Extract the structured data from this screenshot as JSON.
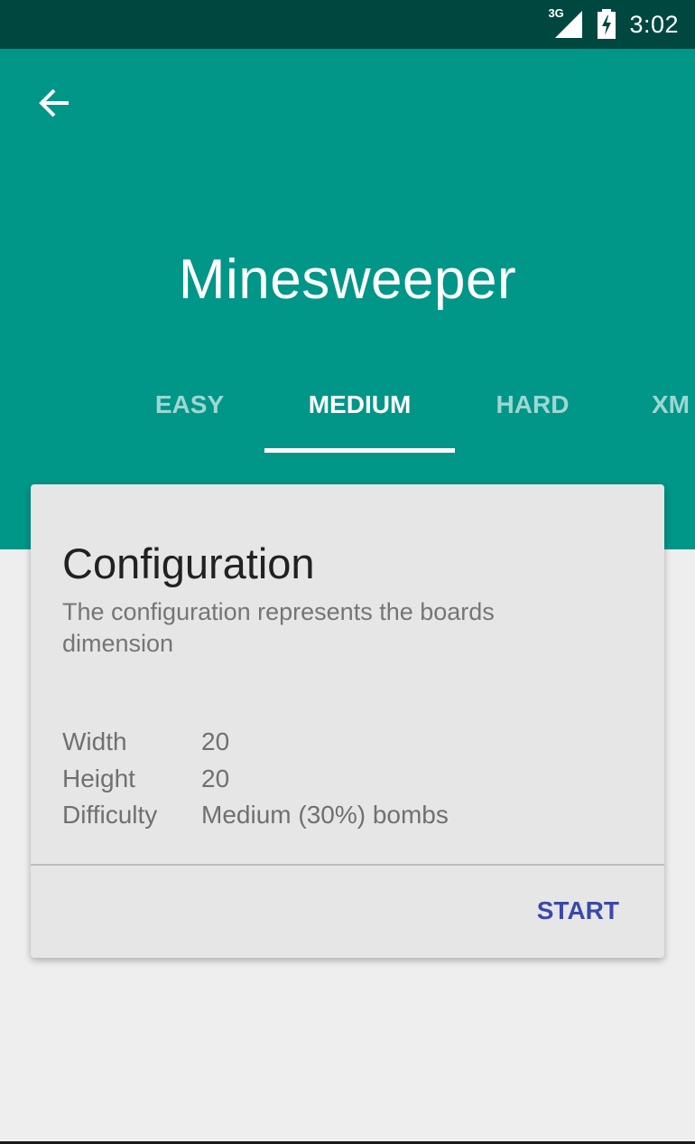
{
  "status_bar": {
    "network_label": "3G",
    "time": "3:02"
  },
  "header": {
    "back_icon": "arrow-left-icon",
    "title": "Minesweeper",
    "colors": {
      "primary": "#009688",
      "primary_dark": "#00483f"
    }
  },
  "tabs": [
    {
      "label": "EASY",
      "active": false
    },
    {
      "label": "MEDIUM",
      "active": true
    },
    {
      "label": "HARD",
      "active": false
    },
    {
      "label": "XM",
      "active": false
    }
  ],
  "card": {
    "title": "Configuration",
    "description": "The configuration represents the boards dimension",
    "rows": [
      {
        "label": "Width",
        "value": "20"
      },
      {
        "label": "Height",
        "value": "20"
      },
      {
        "label": "Difficulty",
        "value": "Medium (30%) bombs"
      }
    ],
    "action_label": "START",
    "accent": "#3949ab"
  }
}
